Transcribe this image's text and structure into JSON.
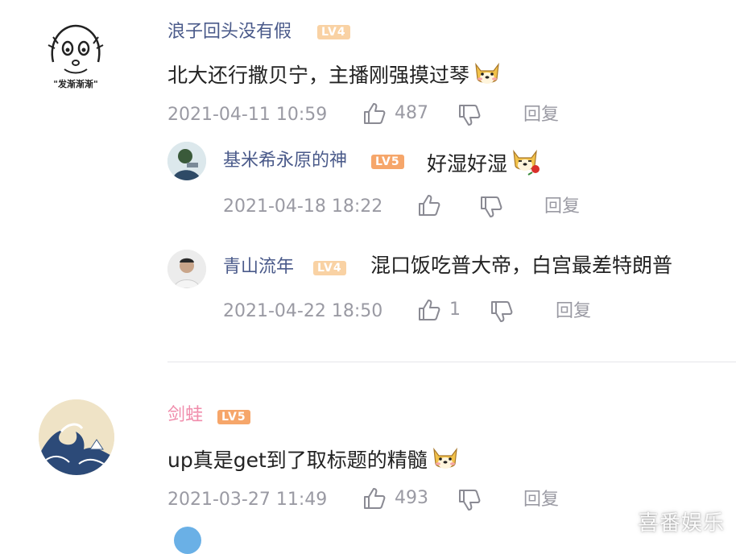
{
  "comments": [
    {
      "user": "浪子回头没有假",
      "level": "LV4",
      "text": "北大还行撒贝宁，主播刚强摸过琴",
      "emoji": "doge-icon",
      "time": "2021-04-11 10:59",
      "likes": "487",
      "reply_label": "回复",
      "avatar_caption": "\"发渐渐渐\""
    },
    {
      "user": "基米希永原的神",
      "level": "LV5",
      "text": "好湿好湿",
      "emoji": "doge-rose-icon",
      "time": "2021-04-18 18:22",
      "likes": "",
      "reply_label": "回复"
    },
    {
      "user": "青山流年",
      "level": "LV4",
      "text": "混口饭吃普大帝，白宫最差特朗普",
      "time": "2021-04-22 18:50",
      "likes": "1",
      "reply_label": "回复"
    },
    {
      "user": "剑蛙",
      "level": "LV5",
      "text": "up真是get到了取标题的精髓",
      "emoji": "doge-icon",
      "time": "2021-03-27 11:49",
      "likes": "493",
      "reply_label": "回复"
    }
  ],
  "watermark": "喜番娱乐",
  "colors": {
    "username": "#4a5a8a",
    "meta": "#9a9aa3",
    "lv4": "#f9d2a4",
    "lv5": "#f6a66a",
    "divider": "#e6e6ea"
  }
}
